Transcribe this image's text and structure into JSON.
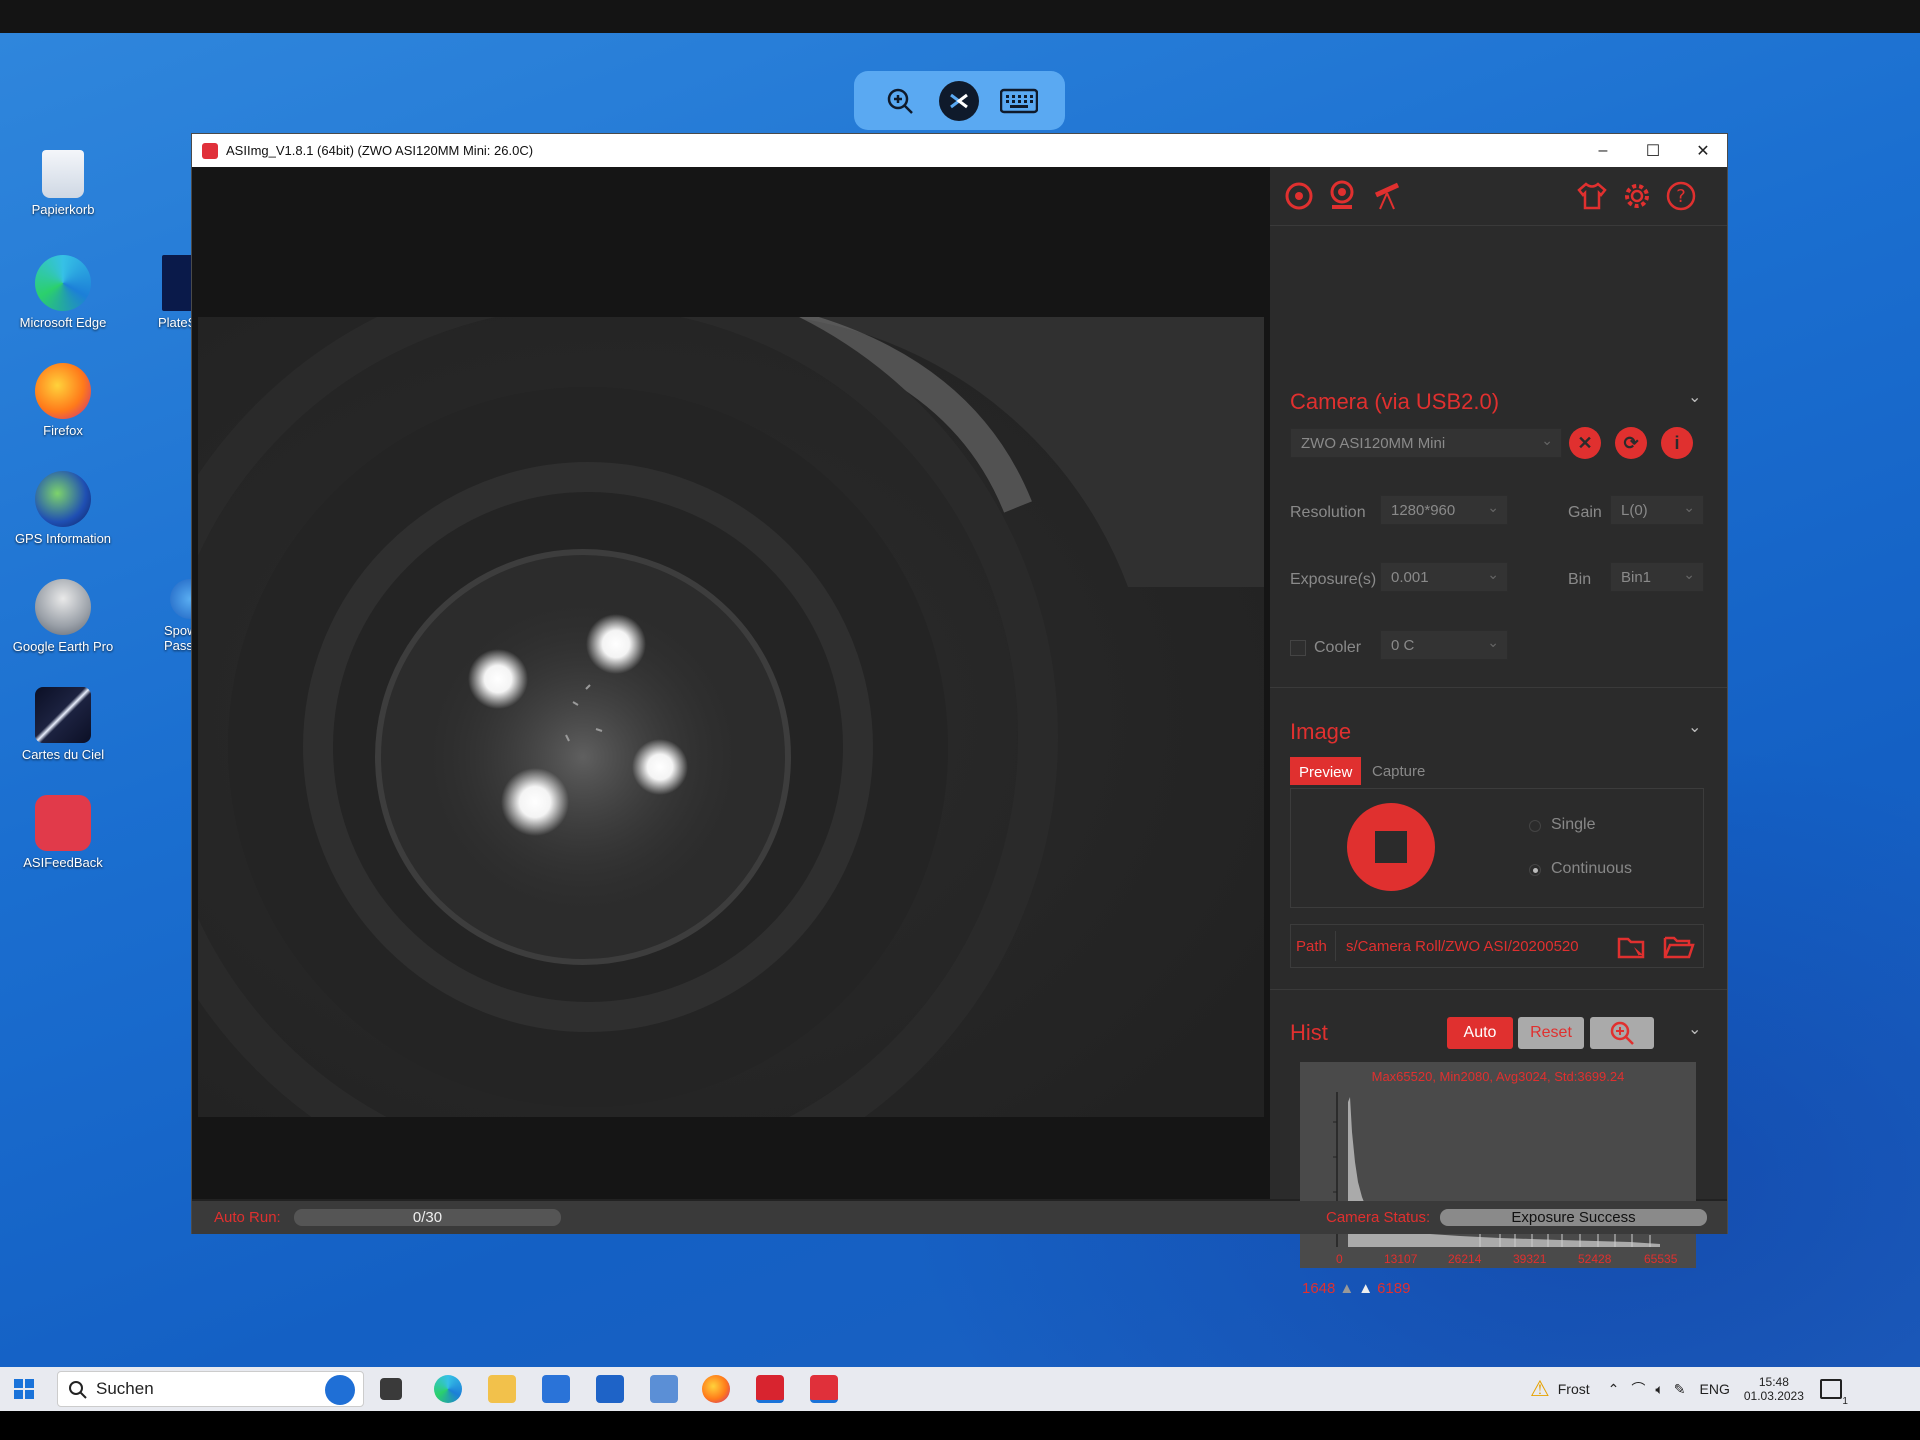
{
  "remote_toolbar": {
    "icons": [
      "zoom-in-icon",
      "remote-connection-icon",
      "keyboard-icon"
    ]
  },
  "desktop": {
    "icons": [
      {
        "label": "Papierkorb",
        "icon": "recycle-bin-icon"
      },
      {
        "label": "Microsoft Edge",
        "icon": "edge-icon"
      },
      {
        "label": "Firefox",
        "icon": "firefox-icon"
      },
      {
        "label": "GPS Information",
        "icon": "globe-icon"
      },
      {
        "label": "Google Earth Pro",
        "icon": "google-earth-icon"
      },
      {
        "label": "Cartes du Ciel",
        "icon": "comet-icon"
      },
      {
        "label": "ASIFeedBack",
        "icon": "chat-icon"
      },
      {
        "label": "PlateS",
        "icon": "platesolve-icon"
      },
      {
        "label": "Spower",
        "label2": "Passwor",
        "icon": "spower-icon"
      }
    ]
  },
  "window": {
    "title": "ASIImg_V1.8.1 (64bit)  (ZWO ASI120MM Mini: 26.0C)",
    "controls": {
      "minimize": "–",
      "maximize": "☐",
      "close": "✕"
    }
  },
  "panel": {
    "top_icons": [
      "camera-shutter-icon",
      "webcam-icon",
      "telescope-icon",
      "shirt-icon",
      "gear-icon",
      "help-icon"
    ],
    "camera": {
      "title": "Camera (via USB2.0)",
      "selected_camera": "ZWO ASI120MM Mini",
      "resolution_label": "Resolution",
      "resolution_value": "1280*960",
      "gain_label": "Gain",
      "gain_value": "L(0)",
      "exposure_label": "Exposure(s)",
      "exposure_value": "0.001",
      "bin_label": "Bin",
      "bin_value": "Bin1",
      "cooler_label": "Cooler",
      "cooler_value": "0 C",
      "cooler_checked": false
    },
    "image": {
      "title": "Image",
      "tabs": [
        "Preview",
        "Capture"
      ],
      "active_tab": "Preview",
      "mode_single": "Single",
      "mode_continuous": "Continuous",
      "selected_mode": "Continuous",
      "path_label": "Path",
      "path_value": "s/Camera Roll/ZWO ASI/20200520"
    },
    "hist": {
      "title": "Hist",
      "auto_label": "Auto",
      "reset_label": "Reset",
      "stats": "Max65520, Min2080, Avg3024, Std:3699.24",
      "x_ticks": [
        "0",
        "13107",
        "26214",
        "39321",
        "52428",
        "65535"
      ],
      "low_marker": "1648",
      "high_marker": "6189"
    }
  },
  "status": {
    "auto_run_label": "Auto Run:",
    "auto_run_value": "0/30",
    "camera_status_label": "Camera Status:",
    "camera_status_value": "Exposure Success"
  },
  "taskbar": {
    "search_placeholder": "Suchen",
    "weather": "Frost",
    "language": "ENG",
    "time": "15:48",
    "date": "01.03.2023",
    "notification_count": "1"
  }
}
